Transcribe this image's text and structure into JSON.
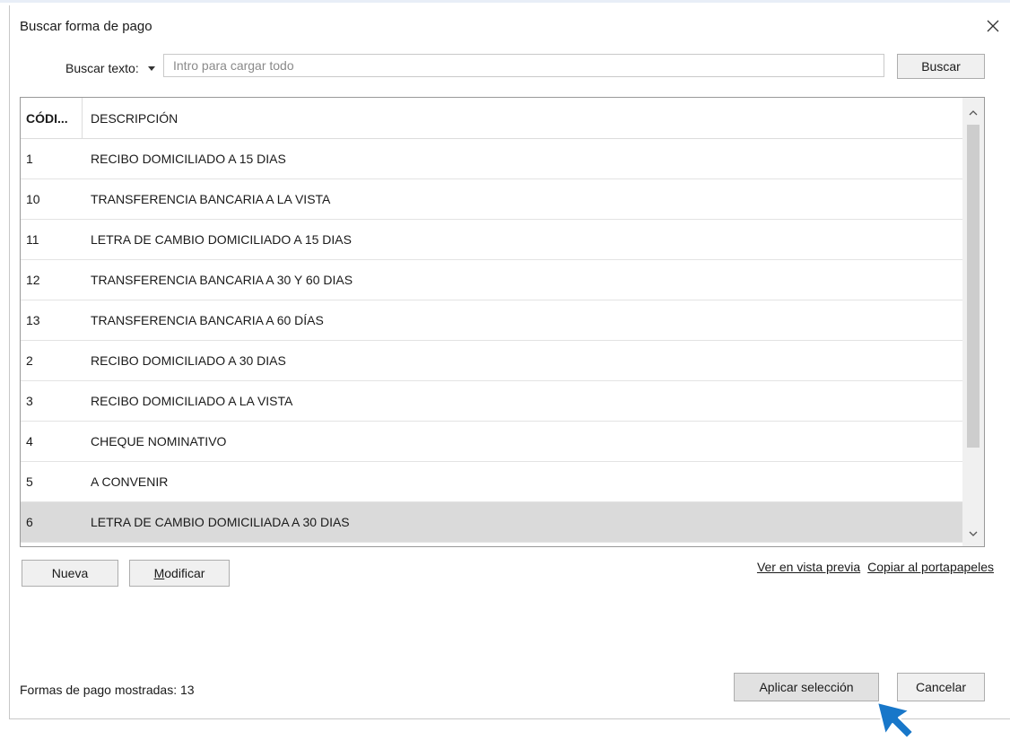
{
  "dialog": {
    "title": "Buscar forma de pago"
  },
  "search": {
    "label": "Buscar texto:",
    "placeholder": "Intro para cargar todo",
    "value": "",
    "button_label": "Buscar"
  },
  "grid": {
    "columns": {
      "code": "CÓDI...",
      "description": "DESCRIPCIÓN"
    },
    "rows": [
      {
        "code": "1",
        "description": "RECIBO DOMICILIADO A 15 DIAS"
      },
      {
        "code": "10",
        "description": "TRANSFERENCIA BANCARIA A LA VISTA"
      },
      {
        "code": "11",
        "description": "LETRA DE CAMBIO DOMICILIADO A 15 DIAS"
      },
      {
        "code": "12",
        "description": "TRANSFERENCIA BANCARIA A 30 Y 60 DIAS"
      },
      {
        "code": "13",
        "description": "TRANSFERENCIA BANCARIA A 60 DÍAS"
      },
      {
        "code": "2",
        "description": "RECIBO DOMICILIADO A 30 DIAS"
      },
      {
        "code": "3",
        "description": "RECIBO DOMICILIADO A LA VISTA"
      },
      {
        "code": "4",
        "description": "CHEQUE NOMINATIVO"
      },
      {
        "code": "5",
        "description": "A CONVENIR"
      },
      {
        "code": "6",
        "description": "LETRA DE CAMBIO DOMICILIADA A 30 DIAS"
      }
    ],
    "selected_code": "6"
  },
  "actions": {
    "new_label": "Nueva",
    "modify_label_first": "M",
    "modify_label_rest": "odificar"
  },
  "links": {
    "preview": "Ver en vista previa",
    "copy": "Copiar al portapapeles"
  },
  "footer": {
    "status": "Formas de pago mostradas: 13",
    "apply_label": "Aplicar selección",
    "cancel_label": "Cancelar"
  },
  "colors": {
    "selected_row": "#dadada",
    "cursor": "#1877c9"
  },
  "icons": {
    "close": "close-icon",
    "dropdown": "caret-down-icon",
    "scroll_up": "chevron-up-icon",
    "scroll_down": "chevron-down-icon",
    "pointer": "mouse-cursor-icon"
  }
}
